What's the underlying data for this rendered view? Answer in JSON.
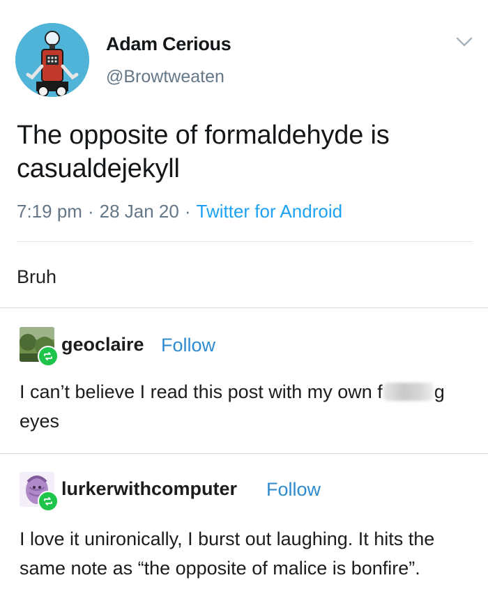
{
  "tweet": {
    "author_name": "Adam Cerious",
    "author_handle": "@Browtweaten",
    "text": "The opposite of formaldehyde is casualdejekyll",
    "time": "7:19 pm",
    "date": "28 Jan 20",
    "source": "Twitter for Android",
    "separator": "·",
    "avatar_icon": "robot-avatar-icon",
    "menu_icon": "chevron-down-icon"
  },
  "caption": "Bruh",
  "reblogs": [
    {
      "username": "geoclaire",
      "follow_label": "Follow",
      "text_before": "I can’t believe I read this post with my own f",
      "text_after": "g eyes",
      "badge_icon": "reblog-icon"
    },
    {
      "username": "lurkerwithcomputer",
      "follow_label": "Follow",
      "text": "I love it unironically, I burst out laughing. It hits the same note as “the opposite of malice is bonfire”.",
      "badge_icon": "reblog-icon"
    }
  ],
  "colors": {
    "link": "#2f8bd0",
    "twitter_blue": "#1da1f2",
    "reblog_green": "#1ec54a",
    "muted": "#657786"
  }
}
